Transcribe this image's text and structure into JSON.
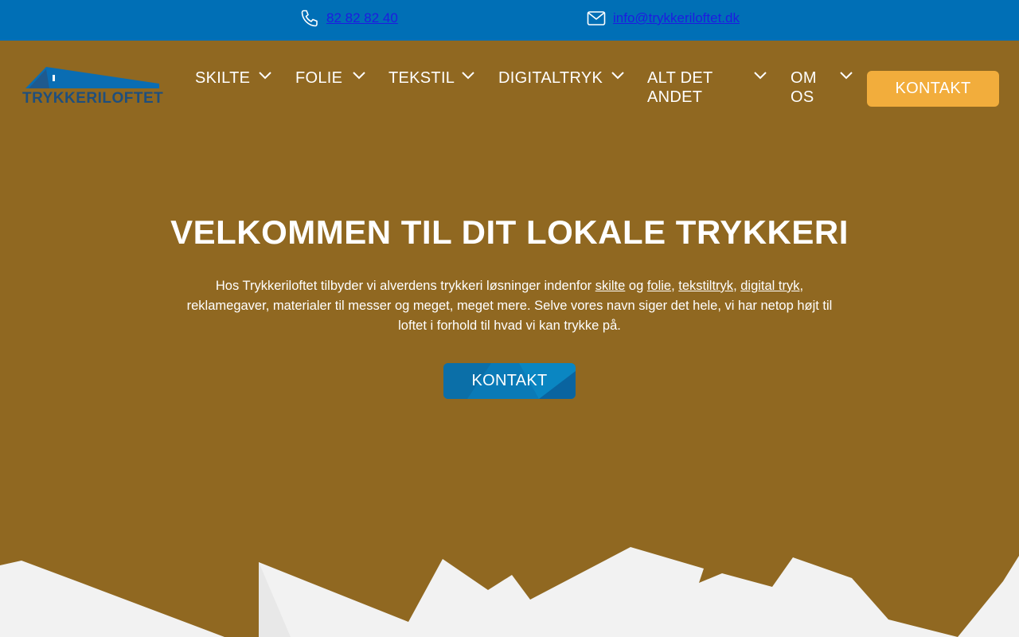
{
  "topbar": {
    "phone": "82 82 82 40",
    "email": "info@trykkeriloftet.dk"
  },
  "logo": {
    "text": "TRYKKERILOFTET"
  },
  "nav": {
    "items": [
      {
        "label": "SKILTE"
      },
      {
        "label": "FOLIE"
      },
      {
        "label": "TEKSTIL"
      },
      {
        "label": "DIGITALTRYK"
      },
      {
        "label_line1": "ALT DET",
        "label_line2": "ANDET"
      },
      {
        "label_line1": "OM",
        "label_line2": "OS"
      }
    ],
    "cta": "KONTAKT"
  },
  "hero": {
    "title": "VELKOMMEN TIL DIT LOKALE TRYKKERI",
    "intro_1": "Hos Trykkeriloftet tilbyder vi alverdens trykkeri løsninger indenfor ",
    "link_skilte": "skilte",
    "og": " og ",
    "link_folie": "folie",
    "comma1": ", ",
    "link_tekstiltryk": "tekstiltryk",
    "comma2": ", ",
    "link_digital": "digital tryk",
    "intro_2": ", reklamegaver, materialer til messer og meget, meget mere. Selve vores navn siger det hele, vi har netop højt til loftet i forhold til hvad vi kan trykke på.",
    "button": "KONTAKT"
  },
  "colors": {
    "topbar": "#006fb6",
    "background": "#906821",
    "cta": "#f2ad3c",
    "hero_button": "#0a7ab7",
    "ground": "#f2f2f2"
  }
}
